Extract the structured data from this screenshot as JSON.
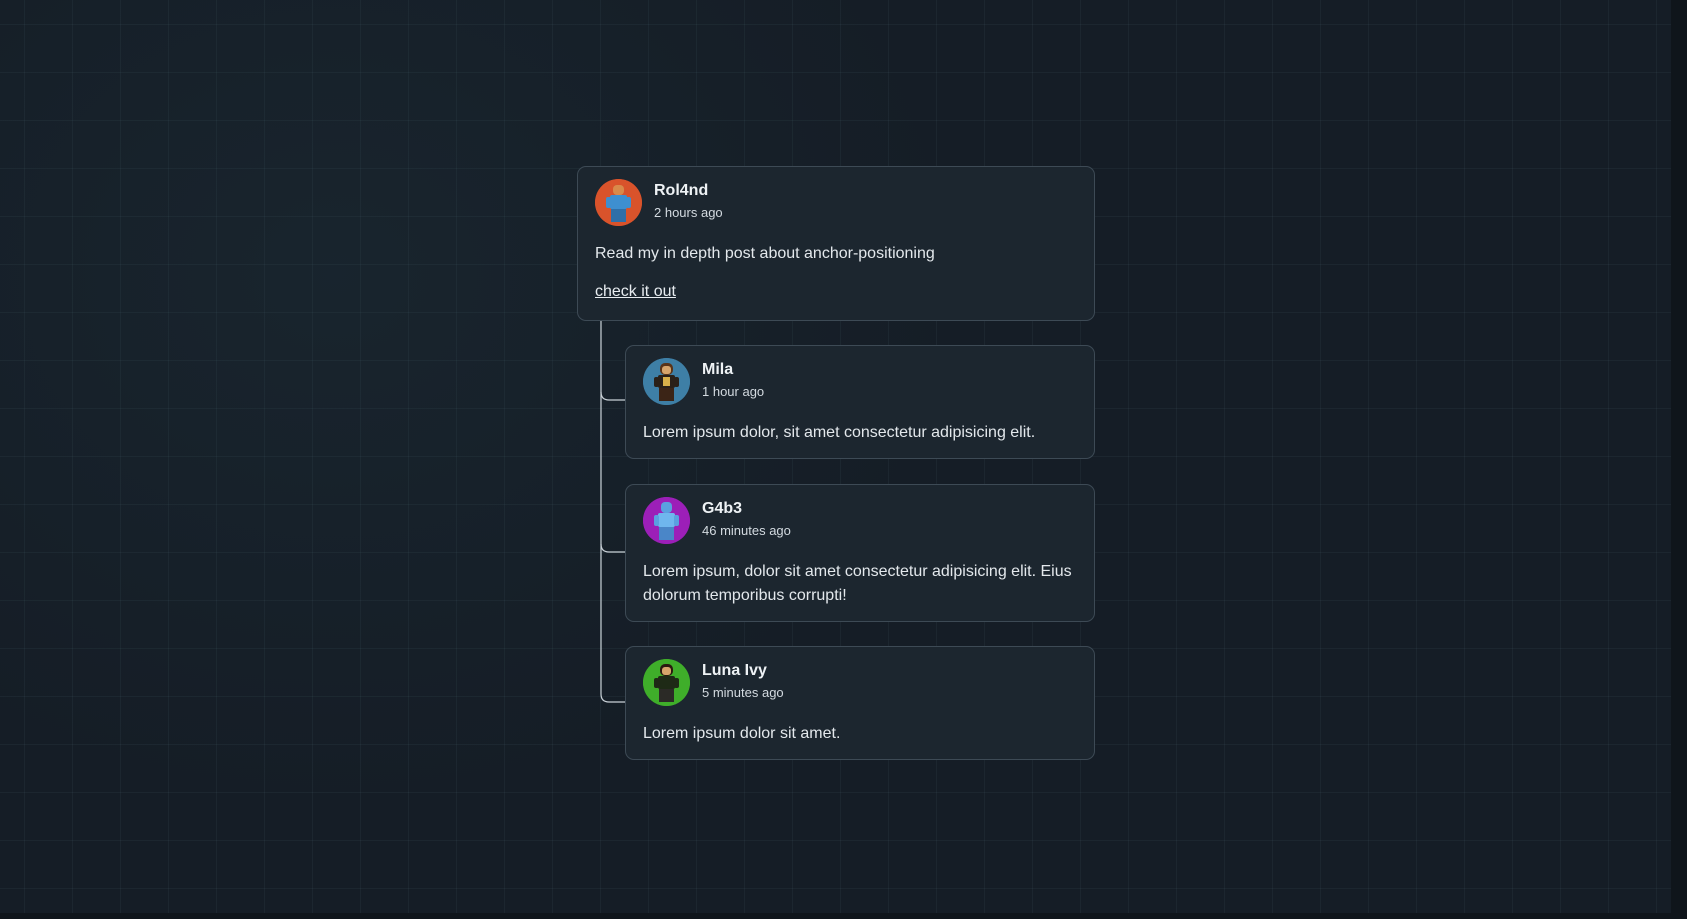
{
  "post": {
    "author": "Rol4nd",
    "time": "2 hours ago",
    "text": "Read my in depth post about anchor-positioning",
    "link_label": "check it out",
    "avatar_color": "#d9532b"
  },
  "replies": [
    {
      "author": "Mila",
      "time": "1 hour ago",
      "text": "Lorem ipsum dolor, sit amet consectetur adipisicing elit.",
      "avatar_color": "#3e7fa6"
    },
    {
      "author": "G4b3",
      "time": "46 minutes ago",
      "text": "Lorem ipsum, dolor sit amet consectetur adipisicing elit. Eius dolorum temporibus corrupti!",
      "avatar_color": "#9c1fb8"
    },
    {
      "author": "Luna Ivy",
      "time": "5 minutes ago",
      "text": "Lorem ipsum dolor sit amet.",
      "avatar_color": "#3fae2a"
    }
  ],
  "colors": {
    "background": "#151d26",
    "card": "#1c262f",
    "card_border": "#3d4a55",
    "connector": "#c9d1d7"
  }
}
